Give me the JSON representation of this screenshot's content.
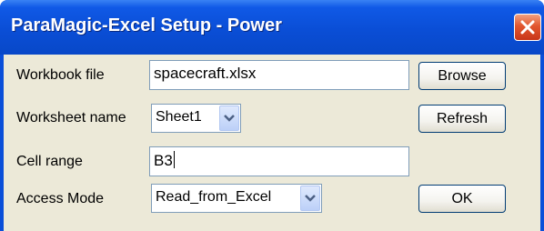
{
  "window": {
    "title": "ParaMagic-Excel Setup - Power",
    "close_icon": "close-icon"
  },
  "form": {
    "workbook_file": {
      "label": "Workbook file",
      "value": "spacecraft.xlsx"
    },
    "worksheet_name": {
      "label": "Worksheet name",
      "value": "Sheet1"
    },
    "cell_range": {
      "label": "Cell range",
      "value": "B3"
    },
    "access_mode": {
      "label": "Access Mode",
      "value": "Read_from_Excel"
    }
  },
  "buttons": {
    "browse": "Browse",
    "refresh": "Refresh",
    "ok": "OK"
  },
  "colors": {
    "titlebar": "#0a4ed6",
    "client_bg": "#ece9d8",
    "close_button": "#e2562e",
    "field_border": "#7f9db9"
  }
}
